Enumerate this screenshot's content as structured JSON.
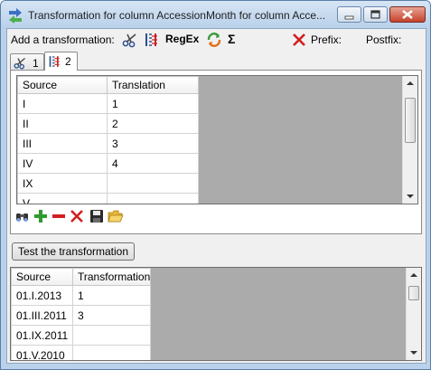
{
  "window": {
    "title": "Transformation for column AccessionMonth for column Acce..."
  },
  "toolbar": {
    "add_label": "Add a transformation:",
    "regex_label": "RegEx",
    "sigma_label": "Σ",
    "prefix_label": "Prefix:",
    "postfix_label": "Postfix:"
  },
  "tabs": [
    {
      "label": "1",
      "icon": "scissors-icon"
    },
    {
      "label": "2",
      "icon": "translation-icon"
    }
  ],
  "translation_grid": {
    "headers": [
      "Source",
      "Translation"
    ],
    "rows": [
      [
        "I",
        "1"
      ],
      [
        "II",
        "2"
      ],
      [
        "III",
        "3"
      ],
      [
        "IV",
        "4"
      ],
      [
        "IX",
        ""
      ],
      [
        "V",
        ""
      ]
    ]
  },
  "grid_tools": [
    "find-icon",
    "add-icon",
    "remove-icon",
    "delete-icon",
    "save-icon",
    "open-folder-icon"
  ],
  "test_button": "Test the transformation",
  "result_grid": {
    "headers": [
      "Source",
      "Transformation"
    ],
    "rows": [
      [
        "01.I.2013",
        "1"
      ],
      [
        "01.III.2011",
        "3"
      ],
      [
        "01.IX.2011",
        ""
      ],
      [
        "01.V.2010",
        ""
      ]
    ]
  },
  "colors": {
    "title_bg": "#b9d1ea",
    "close_button": "#c5422b",
    "add_green": "#2e9b2e",
    "remove_red": "#d21f1f"
  }
}
